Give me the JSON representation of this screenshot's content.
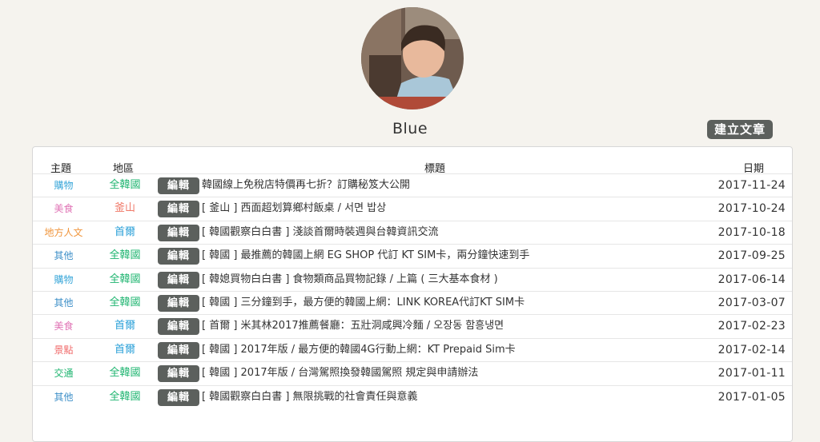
{
  "profile": {
    "username": "Blue"
  },
  "actions": {
    "new_post_label": "建立文章"
  },
  "table": {
    "headers": {
      "topic": "主題",
      "region": "地區",
      "title": "標題",
      "date": "日期"
    },
    "edit_label": "編輯",
    "rows": [
      {
        "topic": "購物",
        "topic_color": "#3aa7d9",
        "region": "全韓國",
        "region_color": "#1db46f",
        "title": "韓國線上免稅店特價再七折？訂購秘笈大公開",
        "date": "2017-11-24"
      },
      {
        "topic": "美食",
        "topic_color": "#e075b6",
        "region": "釜山",
        "region_color": "#f07a6a",
        "title": "[ 釜山 ] 西面超划算鄉村飯桌 / 서면 밥상",
        "date": "2017-10-24"
      },
      {
        "topic": "地方人文",
        "topic_color": "#f0953c",
        "region": "首爾",
        "region_color": "#2aa0d8",
        "title": "[ 韓國觀察白白書 ] 淺談首爾時裝週與台韓資訊交流",
        "date": "2017-10-18"
      },
      {
        "topic": "其他",
        "topic_color": "#3d8fc8",
        "region": "全韓國",
        "region_color": "#1db46f",
        "title": "[ 韓國 ] 最推薦的韓國上網 EG SHOP 代訂 KT SIM卡，兩分鐘快速到手",
        "date": "2017-09-25"
      },
      {
        "topic": "購物",
        "topic_color": "#3aa7d9",
        "region": "全韓國",
        "region_color": "#1db46f",
        "title": "[ 韓媳買物白白書 ] 食物類商品買物記錄 / 上篇 ( 三大基本食材 )",
        "date": "2017-06-14"
      },
      {
        "topic": "其他",
        "topic_color": "#3d8fc8",
        "region": "全韓國",
        "region_color": "#1db46f",
        "title": "[ 韓國 ] 三分鐘到手，最方便的韓國上網：LINK KOREA代訂KT SIM卡",
        "date": "2017-03-07"
      },
      {
        "topic": "美食",
        "topic_color": "#e075b6",
        "region": "首爾",
        "region_color": "#2aa0d8",
        "title": "[ 首爾 ] 米其林2017推薦餐廳：五壯洞咸興冷麵 / 오장동 함흥냉면",
        "date": "2017-02-23"
      },
      {
        "topic": "景點",
        "topic_color": "#f06868",
        "region": "首爾",
        "region_color": "#2aa0d8",
        "title": "[ 韓國 ] 2017年版 / 最方便的韓國4G行動上網：KT Prepaid Sim卡",
        "date": "2017-02-14"
      },
      {
        "topic": "交通",
        "topic_color": "#1db46f",
        "region": "全韓國",
        "region_color": "#1db46f",
        "title": "[ 韓國 ] 2017年版 / 台灣駕照換發韓國駕照 規定與申請辦法",
        "date": "2017-01-11"
      },
      {
        "topic": "其他",
        "topic_color": "#3d8fc8",
        "region": "全韓國",
        "region_color": "#1db46f",
        "title": "[ 韓國觀察白白書 ] 無限挑戰的社會責任與意義",
        "date": "2017-01-05"
      }
    ]
  }
}
